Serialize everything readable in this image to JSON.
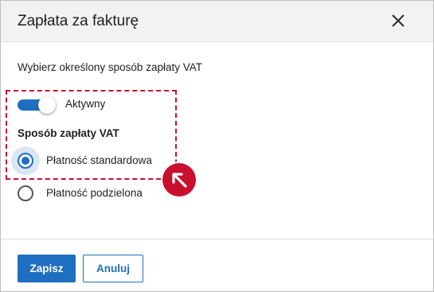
{
  "dialog": {
    "title": "Zapłata za fakturę",
    "close_icon": "close-icon"
  },
  "content": {
    "instruction": "Wybierz określony sposób zapłaty VAT",
    "toggle": {
      "label": "Aktywny",
      "on": true
    },
    "section_label": "Sposób zapłaty VAT",
    "options": [
      {
        "label": "Płatność standardowa",
        "selected": true
      },
      {
        "label": "Płatność podzielona",
        "selected": false
      }
    ],
    "pointer_icon": "arrow-up-left-icon"
  },
  "footer": {
    "save_label": "Zapisz",
    "cancel_label": "Anuluj"
  },
  "colors": {
    "accent": "#1f6fc0",
    "highlight": "#c8102e",
    "header_bg": "#f2f2f2"
  }
}
